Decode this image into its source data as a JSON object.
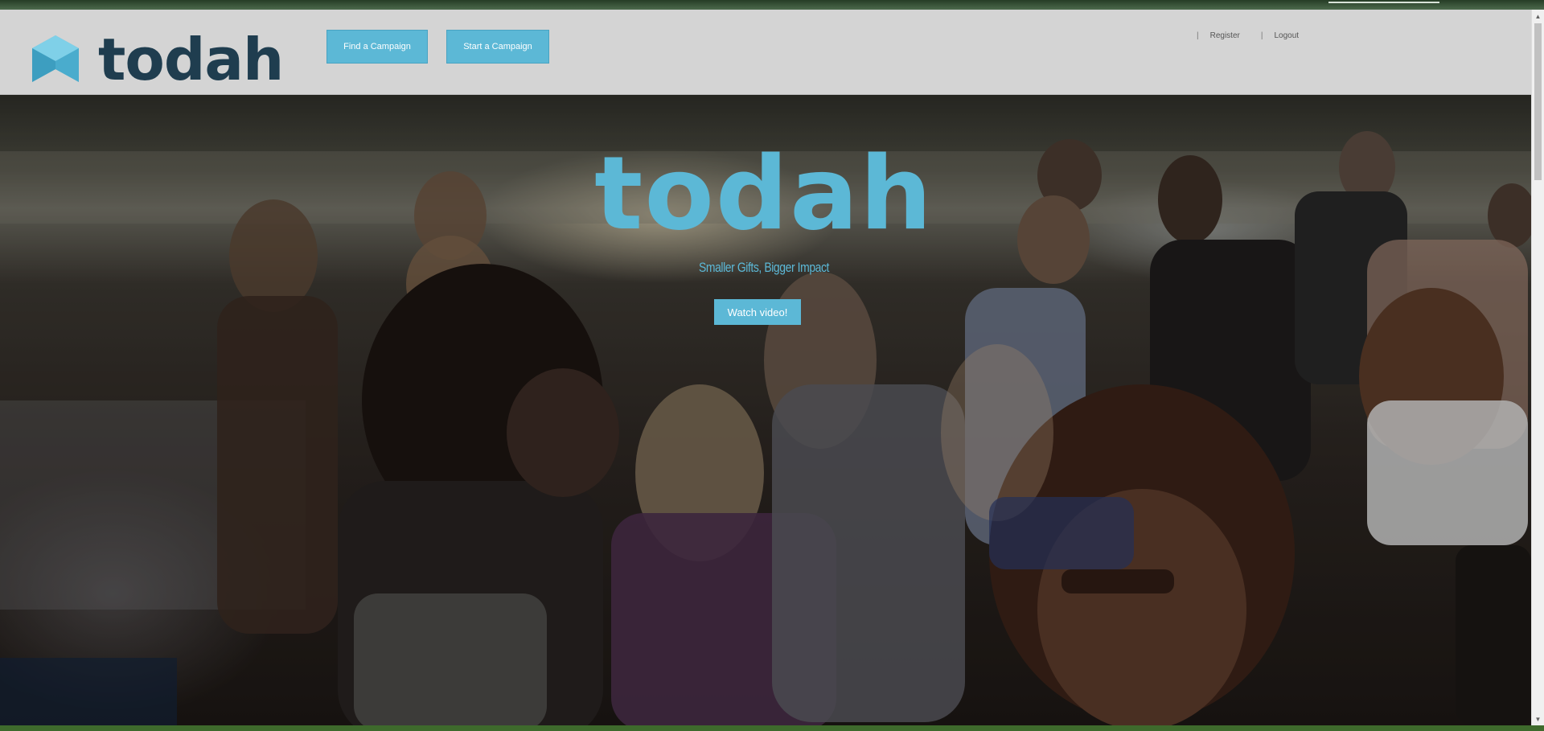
{
  "header": {
    "logo_text": "todah",
    "nav": {
      "find_label": "Find a Campaign",
      "start_label": "Start a Campaign"
    },
    "links": {
      "register_label": "Register",
      "logout_label": "Logout",
      "separator": "|"
    }
  },
  "hero": {
    "title": "todah",
    "tagline": "Smaller Gifts, Bigger Impact",
    "watch_label": "Watch video!"
  },
  "colors": {
    "accent": "#5cb8d6",
    "logo_dark": "#1f3d4f",
    "header_bg": "#d4d4d4"
  },
  "icons": {
    "logo_mark": "envelope-cube-logo-icon",
    "scroll_up": "scroll-up-arrow-icon",
    "scroll_down": "scroll-down-arrow-icon"
  }
}
